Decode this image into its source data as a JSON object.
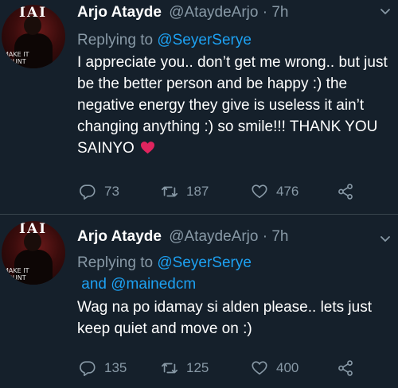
{
  "avatar": {
    "text_top": "IAI",
    "text_side": "MAKE IT\nCOUNT"
  },
  "tweets": [
    {
      "name": "Arjo Atayde",
      "handle": "@AtaydeArjo",
      "separator": "·",
      "time": "7h",
      "replying_prefix": "Replying to ",
      "mentions": [
        "@SeyerSerye"
      ],
      "mention_joiner": "",
      "text": "I appreciate you.. don’t get me wrong.. but just be the better person and be happy :) the negative energy they give is useless it ain’t changing anything :) so smile!!! THANK YOU SAINYO",
      "emoji": "red-heart",
      "stats": {
        "replies": "73",
        "retweets": "187",
        "likes": "476"
      }
    },
    {
      "name": "Arjo Atayde",
      "handle": "@AtaydeArjo",
      "separator": "·",
      "time": "7h",
      "replying_prefix": "Replying to ",
      "mentions": [
        "@SeyerSerye",
        "@mainedcm"
      ],
      "mention_joiner": " and ",
      "text": "Wag na po idamay si alden please.. lets just keep quiet and move on :)",
      "emoji": "",
      "stats": {
        "replies": "135",
        "retweets": "125",
        "likes": "400"
      }
    }
  ],
  "colors": {
    "background": "#15202b",
    "secondary_text": "#8899a6",
    "mention": "#1da1f2",
    "divider": "#38444d",
    "heart": "#e0245e"
  }
}
